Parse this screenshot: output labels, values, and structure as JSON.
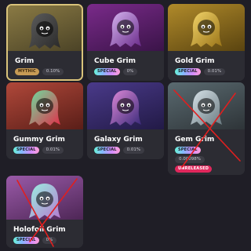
{
  "cards": [
    {
      "name": "Grim",
      "badge": "MYTHIC",
      "pct": "0.10%",
      "selected": true,
      "bg": "linear-gradient(160deg,#8a7a44,#4a4226)",
      "ghost": [
        "#2a2a2a",
        "#5c5c5c"
      ]
    },
    {
      "name": "Cube Grim",
      "badge": "SPECIAL",
      "pct": "0%",
      "selected": false,
      "bg": "linear-gradient(160deg,#7a2a8a,#3a1448)",
      "ghost": [
        "#6a2a8a",
        "#d6b6f0"
      ]
    },
    {
      "name": "Gold Grim",
      "badge": "SPECIAL",
      "pct": "0.01%",
      "selected": false,
      "bg": "linear-gradient(160deg,#b08a2a,#5a4410)",
      "ghost": [
        "#9a7418",
        "#f2d46a"
      ]
    },
    {
      "name": "Gummy Grim",
      "badge": "SPECIAL",
      "pct": "0.01%",
      "selected": false,
      "bg": "linear-gradient(160deg,#b0483a,#5a1e18)",
      "ghost": [
        "#e2304a",
        "#6ae0a0"
      ]
    },
    {
      "name": "Galaxy Grim",
      "badge": "SPECIAL",
      "pct": "0.01%",
      "selected": false,
      "bg": "linear-gradient(160deg,#4a3a8a,#221a46)",
      "ghost": [
        "#3a2a7a",
        "#e08ad8"
      ]
    },
    {
      "name": "Gem Grim",
      "badge": "SPECIAL",
      "pct": "0.00098%",
      "extra": "UNRELEASED",
      "selected": false,
      "crossed": true,
      "bg": "linear-gradient(160deg,#5a6a70,#2e3438)",
      "ghost": [
        "#6a7a80",
        "#d8e4ea"
      ]
    },
    {
      "name": "Holofoil Grim",
      "badge": "SPECIAL",
      "pct": "0%",
      "selected": false,
      "crossed": true,
      "bg": "linear-gradient(160deg,#9a5aa8,#4a2452)",
      "ghost": [
        "#b47ad0",
        "#9af0e0"
      ]
    }
  ]
}
